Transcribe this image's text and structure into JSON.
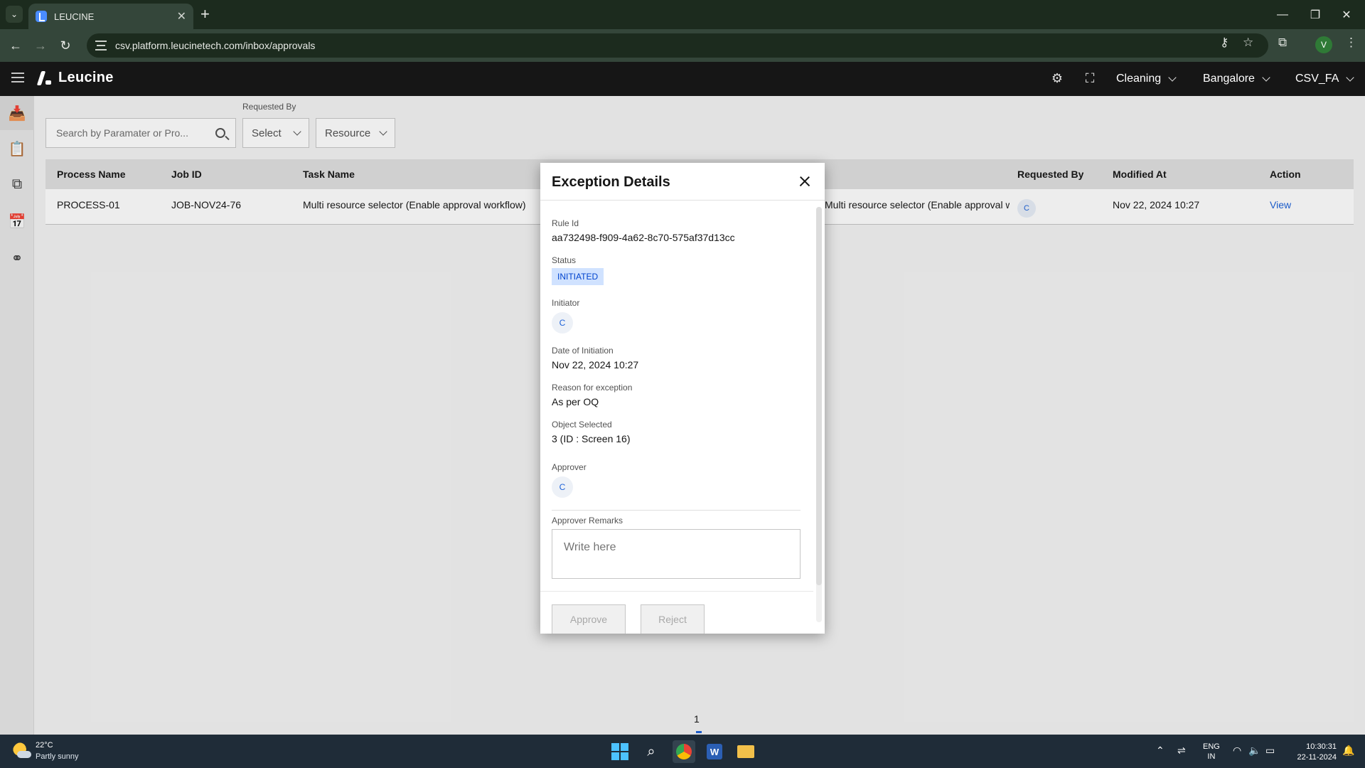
{
  "browser": {
    "tab_title": "LEUCINE",
    "url": "csv.platform.leucinetech.com/inbox/approvals",
    "profile_initial": "V"
  },
  "app": {
    "brand": "Leucine",
    "selectors": {
      "use_case": "Cleaning",
      "facility": "Bangalore",
      "user": "CSV_FA"
    }
  },
  "filters": {
    "search_placeholder": "Search by Paramater or Pro...",
    "requested_by_label": "Requested By",
    "requested_by_value": "Select",
    "resource_value": "Resource"
  },
  "table": {
    "headers": {
      "process_name": "Process Name",
      "job_id": "Job ID",
      "task_name": "Task Name",
      "requested_by": "Requested By",
      "modified_at": "Modified At",
      "action": "Action"
    },
    "rows": [
      {
        "process_name": "PROCESS-01",
        "job_id": "JOB-NOV24-76",
        "task_name": "Multi resource selector (Enable approval workflow)",
        "parameter_name": "Multi resource selector (Enable approval workflow)",
        "requested_by_initial": "C",
        "modified_at": "Nov 22, 2024 10:27",
        "action": "View"
      }
    ]
  },
  "modal": {
    "title": "Exception Details",
    "rule_id_label": "Rule Id",
    "rule_id": "aa732498-f909-4a62-8c70-575af37d13cc",
    "status_label": "Status",
    "status": "INITIATED",
    "initiator_label": "Initiator",
    "initiator_initial": "C",
    "date_label": "Date of Initiation",
    "date": "Nov 22, 2024 10:27",
    "reason_label": "Reason for exception",
    "reason": "As per OQ",
    "object_label": "Object Selected",
    "object": "3 (ID : Screen 16)",
    "approver_label": "Approver",
    "approver_initial": "C",
    "remarks_label": "Approver Remarks",
    "remarks_placeholder": "Write here",
    "approve_label": "Approve",
    "reject_label": "Reject"
  },
  "pagination": {
    "current_page": "1"
  },
  "taskbar": {
    "temperature": "22°C",
    "weather": "Partly sunny",
    "lang_line1": "ENG",
    "lang_line2": "IN",
    "time": "10:30:31",
    "date": "22-11-2024"
  },
  "colors": {
    "accent": "#1d62d8",
    "header_bg": "#161616",
    "badge_bg": "#d0e2ff"
  }
}
